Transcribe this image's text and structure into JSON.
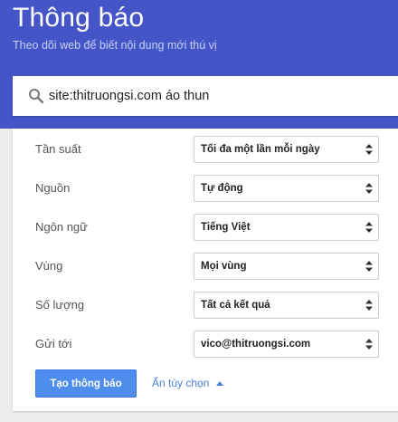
{
  "header": {
    "title": "Thông báo",
    "subtitle": "Theo dõi web để biết nội dung mới thú vị",
    "background_color": "#4355c7"
  },
  "search": {
    "icon": "search-icon",
    "value": "site:thitruongsi.com áo thun"
  },
  "options": [
    {
      "label": "Tần suất",
      "value": "Tối đa một lần mỗi ngày"
    },
    {
      "label": "Nguồn",
      "value": "Tự động"
    },
    {
      "label": "Ngôn ngữ",
      "value": "Tiếng Việt"
    },
    {
      "label": "Vùng",
      "value": "Mọi vùng"
    },
    {
      "label": "Số lượng",
      "value": "Tất cả kết quả"
    },
    {
      "label": "Gửi tới",
      "value": "vico@thitruongsi.com"
    }
  ],
  "actions": {
    "create_label": "Tạo thông báo",
    "hide_options_label": "Ẩn tùy chọn",
    "accent_color": "#4d8ded"
  }
}
